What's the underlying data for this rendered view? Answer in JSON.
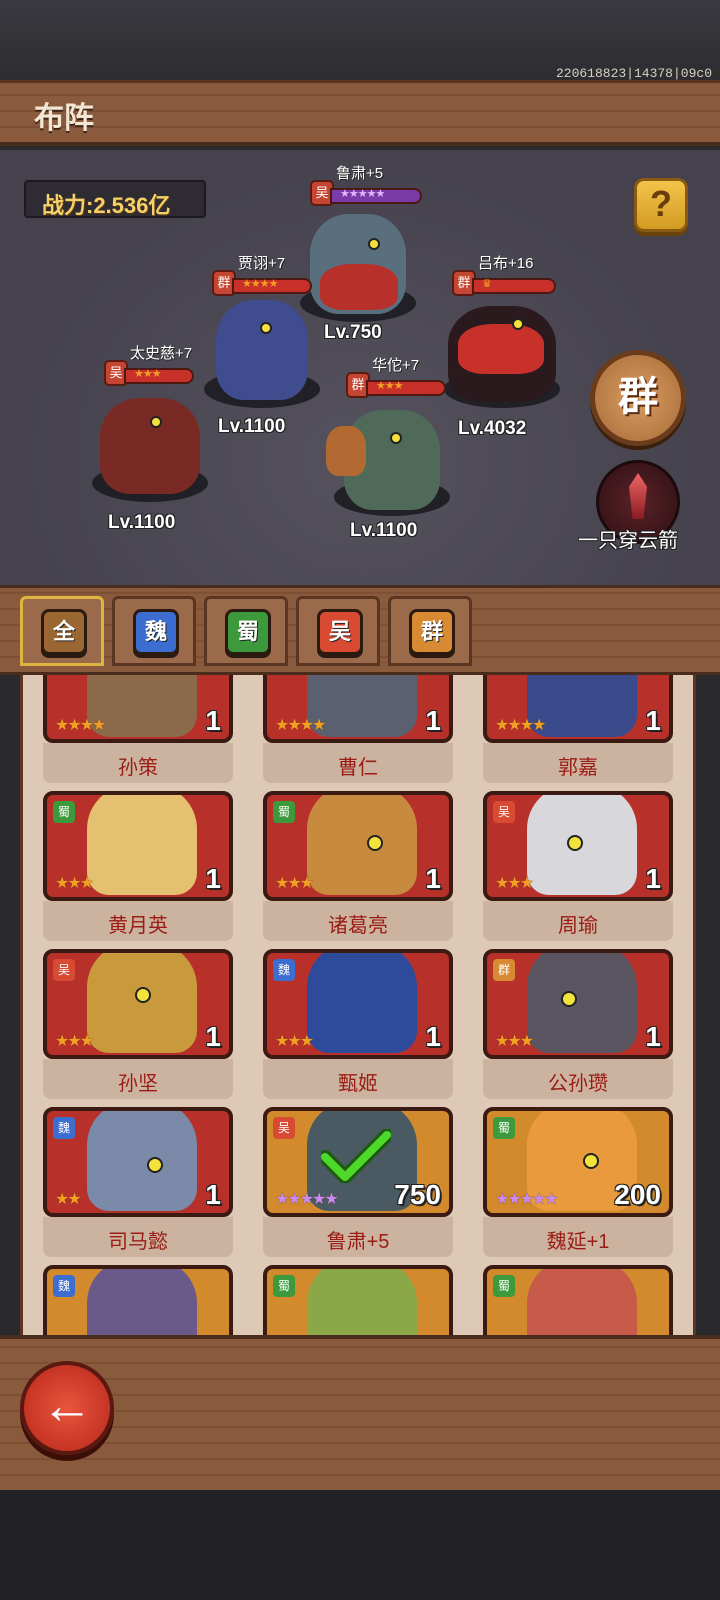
{
  "debug": {
    "id_text": "220618823|14378|09c0"
  },
  "header": {
    "title": "布阵"
  },
  "battle": {
    "power_text": "战力:2.536亿",
    "help_label": "?",
    "faction_badge": "群",
    "skill_label": "一只穿云箭",
    "heroes": [
      {
        "name": "鲁肃+5",
        "faction": "吴",
        "level": "Lv.750",
        "star_color": "purple"
      },
      {
        "name": "贾诩+7",
        "faction": "群",
        "level": "Lv.1100",
        "star_color": "gold"
      },
      {
        "name": "吕布+16",
        "faction": "群",
        "level": "Lv.4032",
        "star_color": "gold"
      },
      {
        "name": "太史慈+7",
        "faction": "吴",
        "level": "Lv.1100",
        "star_color": "gold"
      },
      {
        "name": "华佗+7",
        "faction": "群",
        "level": "Lv.1100",
        "star_color": "gold"
      }
    ]
  },
  "tabs": [
    {
      "label": "全",
      "color": "#9a6632",
      "active": true
    },
    {
      "label": "魏",
      "color": "#3c6ed2",
      "active": false
    },
    {
      "label": "蜀",
      "color": "#3c9a3c",
      "active": false
    },
    {
      "label": "吴",
      "color": "#d84a32",
      "active": false
    },
    {
      "label": "群",
      "color": "#d88a32",
      "active": false
    }
  ],
  "roster": [
    {
      "name": "孙策",
      "faction": "",
      "stars": "★★★★",
      "count": "1"
    },
    {
      "name": "曹仁",
      "faction": "",
      "stars": "★★★★",
      "count": "1"
    },
    {
      "name": "郭嘉",
      "faction": "",
      "stars": "★★★★",
      "count": "1"
    },
    {
      "name": "黄月英",
      "faction": "蜀",
      "stars": "★★★",
      "count": "1"
    },
    {
      "name": "诸葛亮",
      "faction": "蜀",
      "stars": "★★★",
      "count": "1"
    },
    {
      "name": "周瑜",
      "faction": "吴",
      "stars": "★★★",
      "count": "1"
    },
    {
      "name": "孙坚",
      "faction": "吴",
      "stars": "★★★",
      "count": "1"
    },
    {
      "name": "甄姬",
      "faction": "魏",
      "stars": "★★★",
      "count": "1"
    },
    {
      "name": "公孙瓒",
      "faction": "群",
      "stars": "★★★",
      "count": "1"
    },
    {
      "name": "司马懿",
      "faction": "魏",
      "stars": "★★",
      "count": "1"
    },
    {
      "name": "鲁肃+5",
      "faction": "吴",
      "stars": "★★★★★",
      "count": "750",
      "selected": true
    },
    {
      "name": "魏延+1",
      "faction": "蜀",
      "stars": "★★★★★",
      "count": "200"
    },
    {
      "name": "",
      "faction": "魏",
      "stars": "",
      "count": ""
    },
    {
      "name": "",
      "faction": "蜀",
      "stars": "",
      "count": ""
    },
    {
      "name": "",
      "faction": "蜀",
      "stars": "",
      "count": ""
    }
  ],
  "faction_colors": {
    "魏": "#3c6ed2",
    "蜀": "#3c9a3c",
    "吴": "#d84a32",
    "群": "#d88a32"
  },
  "bottom": {
    "back_icon": "←"
  }
}
